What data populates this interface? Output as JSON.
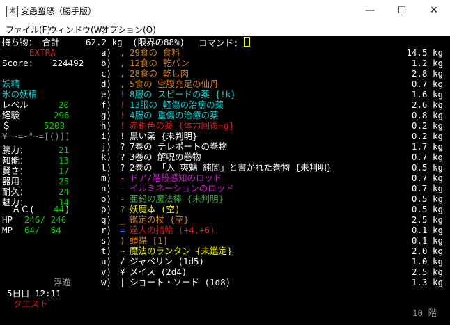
{
  "window": {
    "title": "変愚蛮怒（勝手版）",
    "icon": "app-icon",
    "controls": [
      "minimize-icon",
      "maximize-icon",
      "close-icon"
    ]
  },
  "menu": [
    "ファイル(F)",
    "ウィンドウ(W)",
    "オプション(O)"
  ],
  "header": {
    "label": "持ち物： 合計",
    "weight": "62.2 kg",
    "limit": "(限界の88%)",
    "command": "コマンド:"
  },
  "status": {
    "extra": "EXTRA",
    "score_label": "Score:",
    "score": "224492",
    "race": "妖精",
    "class": "氷の妖精",
    "level_label": "レベル",
    "level": "20",
    "exp_label": "経験",
    "exp": "296",
    "gold_label": "＄",
    "gold": "5203",
    "equip_row": "¥ ~=-\"~=[()]]",
    "stats": [
      {
        "label": "腕力：",
        "value": "21"
      },
      {
        "label": "知能：",
        "value": "13"
      },
      {
        "label": "賢さ：",
        "value": "17"
      },
      {
        "label": "器用：",
        "value": "25"
      },
      {
        "label": "耐久：",
        "value": "24"
      },
      {
        "label": "魅力：",
        "value": "14"
      }
    ],
    "ac_label": "ＡＣ(",
    "ac": "44",
    "ac_close": ")",
    "hp_label": "HP",
    "hp": "246/ 246",
    "mp_label": "MP",
    "mp": "64/  64",
    "levitation": "浮遊",
    "day": "5日目 12:11",
    "quest": "クエスト",
    "floor": "10 階"
  },
  "inventory": [
    {
      "key": "a)",
      "sym": ",",
      "name": "29食の 食料",
      "weight": "14.5 kg"
    },
    {
      "key": "b)",
      "sym": ",",
      "name": "12食の 乾パン",
      "weight": "1.2 kg"
    },
    {
      "key": "c)",
      "sym": ",",
      "name": "28食の 乾し肉",
      "weight": "2.8 kg"
    },
    {
      "key": "d)",
      "sym": ",",
      "name": "5食の 空腹充足の仙丹",
      "weight": "0.7 kg"
    },
    {
      "key": "e)",
      "sym": "!",
      "name": "8服の スピードの薬 {!k}",
      "weight": "1.6 kg"
    },
    {
      "key": "f)",
      "sym": "!",
      "name": "13服の 軽傷の治癒の薬",
      "weight": "2.6 kg"
    },
    {
      "key": "g)",
      "sym": "!",
      "name": "4服の 重傷の治癒の薬",
      "weight": "0.8 kg"
    },
    {
      "key": "h)",
      "sym": "!",
      "name": "赤銅色の薬 {体力回復=g}",
      "weight": "0.2 kg"
    },
    {
      "key": "i)",
      "sym": "!",
      "name": "黒い薬 {未判明}",
      "weight": "0.2 kg"
    },
    {
      "key": "j)",
      "sym": "?",
      "name": "7巻の テレポートの巻物",
      "weight": "1.7 kg"
    },
    {
      "key": "k)",
      "sym": "?",
      "name": "3巻の 解呪の巻物",
      "weight": "0.7 kg"
    },
    {
      "key": "l)",
      "sym": "?",
      "name": "2巻の 「入 爽魑 純闇」と書かれた巻物 {未判明}",
      "weight": "0.5 kg"
    },
    {
      "key": "m)",
      "sym": "-",
      "name": "ドア/階段感知のロッド",
      "weight": "0.7 kg"
    },
    {
      "key": "n)",
      "sym": "-",
      "name": "イルミネーションのロッド",
      "weight": "0.7 kg"
    },
    {
      "key": "o)",
      "sym": "-",
      "name": "亜鉛の魔法棒 {未判明}",
      "weight": "0.5 kg"
    },
    {
      "key": "p)",
      "sym": "?",
      "name": "妖魔本 (空)",
      "weight": "0.5 kg"
    },
    {
      "key": "q)",
      "sym": "_",
      "name": "鑑定の杖 {空}",
      "weight": "2.5 kg"
    },
    {
      "key": "r)",
      "sym": "=",
      "name": "達人の指輪 (+4,+6)",
      "weight": "0.1 kg"
    },
    {
      "key": "s)",
      "sym": ")",
      "name": "頭襟 [1]",
      "weight": "0.1 kg"
    },
    {
      "key": "t)",
      "sym": "~",
      "name": "魔法のランタン {未鑑定}",
      "weight": "2.0 kg"
    },
    {
      "key": "u)",
      "sym": "/",
      "name": "ジャベリン (1d5)",
      "weight": "1.0 kg"
    },
    {
      "key": "v)",
      "sym": "¥",
      "name": "メイス (2d4)",
      "weight": "2.5 kg"
    },
    {
      "key": "w)",
      "sym": "|",
      "name": "ショート・ソード (1d8)",
      "weight": "1.3 kg"
    }
  ],
  "colors": {
    "a)": "#d08020",
    "b)": "#d08020",
    "c)": "#d08020",
    "d)": "#d08020",
    "e)": "#10d0d0",
    "f)": "#10d0d0",
    "g)": "#10d0d0",
    "h)": "#d02020",
    "i)": "#ffffff",
    "j)": "#ffffff",
    "k)": "#ffffff",
    "l)": "#ffffff",
    "m)": "#d020d0",
    "n)": "#d020d0",
    "o)": "#40a040",
    "p)": "#f0f000",
    "q)": "#d08020",
    "r)": "#d02020",
    "s)": "#d08020",
    "t)": "#f0f000",
    "u)": "#ffffff",
    "v)": "#ffffff",
    "w)": "#ffffff"
  },
  "sym_colors": {
    "e)": "#2060ff",
    "f)": "#d02020",
    "g)": "#d02020",
    "h)": "#d02020",
    "i)": "#ffffff",
    "p)": "#40a040",
    "r)": "#2060ff"
  }
}
